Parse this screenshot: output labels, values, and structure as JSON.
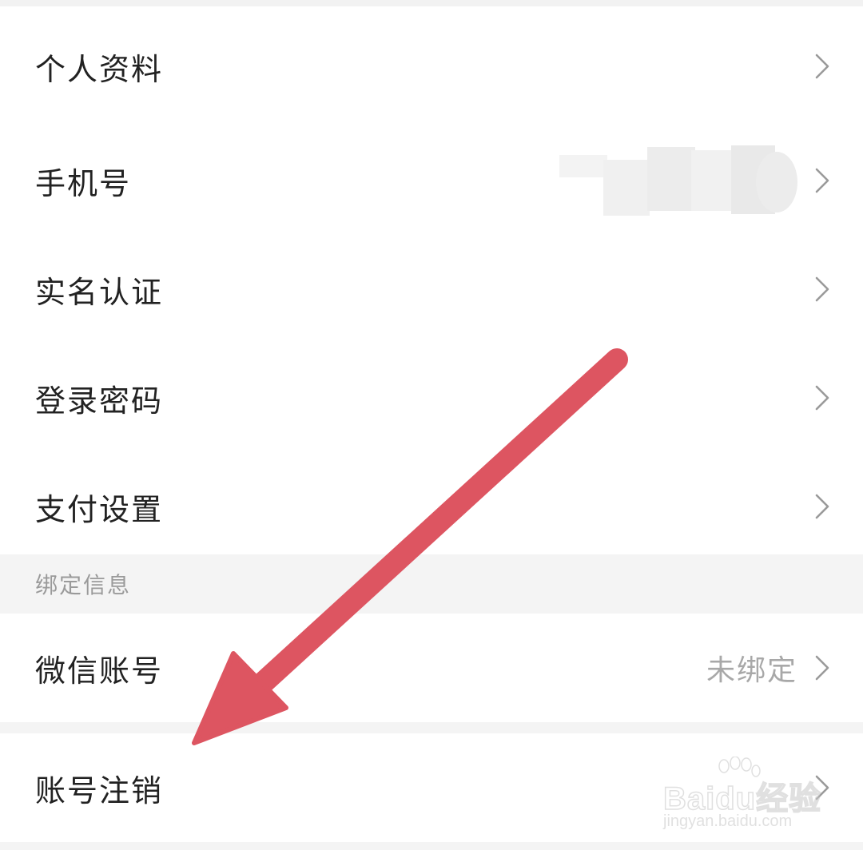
{
  "settings": {
    "rows": [
      {
        "label": "个人资料",
        "value": ""
      },
      {
        "label": "手机号",
        "value": ""
      },
      {
        "label": "实名认证",
        "value": ""
      },
      {
        "label": "登录密码",
        "value": ""
      },
      {
        "label": "支付设置",
        "value": ""
      }
    ]
  },
  "binding": {
    "section_title": "绑定信息",
    "wechat": {
      "label": "微信账号",
      "status": "未绑定"
    }
  },
  "account": {
    "cancel_label": "账号注销"
  },
  "watermark": {
    "brand": "Baidu经验",
    "url": "jingyan.baidu.com"
  },
  "colors": {
    "arrow": "#dd5561",
    "background": "#f4f4f4",
    "row_bg": "#ffffff",
    "label_text": "#222222",
    "secondary_text": "#a8a8a8"
  },
  "icons": {
    "row_chevron": "chevron-right-icon"
  }
}
